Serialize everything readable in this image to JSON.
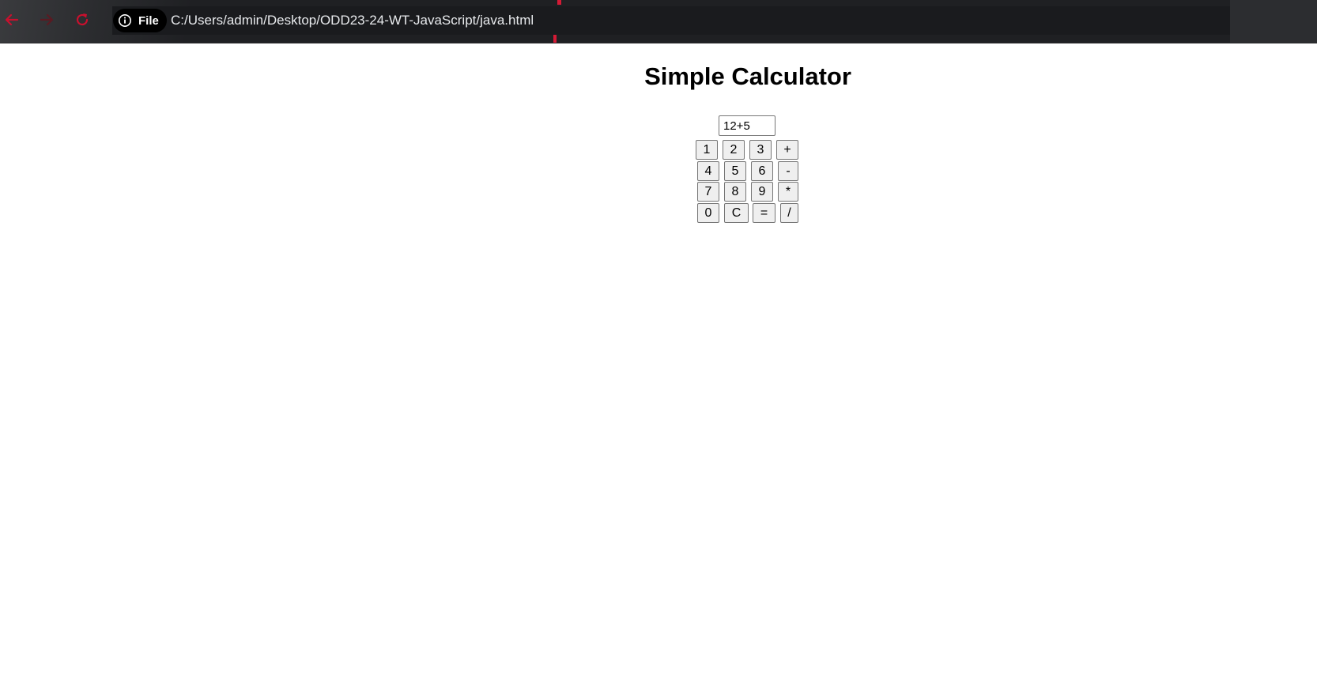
{
  "browser": {
    "chip_label": "File",
    "url": "C:/Users/admin/Desktop/ODD23-24-WT-JavaScript/java.html",
    "accent_color": "#d51a35"
  },
  "page": {
    "title": "Simple Calculator"
  },
  "calculator": {
    "display_value": "12+5",
    "keys": {
      "k1": "1",
      "k2": "2",
      "k3": "3",
      "plus": "+",
      "k4": "4",
      "k5": "5",
      "k6": "6",
      "minus": "-",
      "k7": "7",
      "k8": "8",
      "k9": "9",
      "multiply": "*",
      "k0": "0",
      "clear": "C",
      "equals": "=",
      "divide": "/"
    }
  }
}
